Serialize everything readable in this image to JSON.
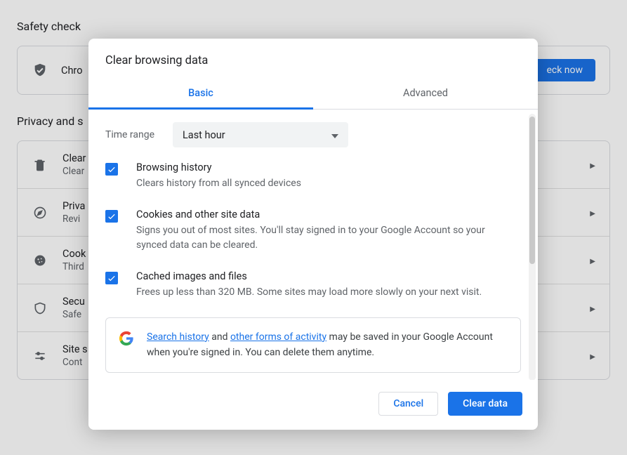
{
  "bg": {
    "safety_title": "Safety check",
    "safety_row_text": "Chro",
    "check_now": "eck now",
    "privacy_title": "Privacy and s",
    "rows": [
      {
        "icon": "trash",
        "p": "Clear",
        "s": "Clear"
      },
      {
        "icon": "compass",
        "p": "Priva",
        "s": "Revi"
      },
      {
        "icon": "cookie",
        "p": "Cook",
        "s": "Third"
      },
      {
        "icon": "shield",
        "p": "Secu",
        "s": "Safe"
      },
      {
        "icon": "sliders",
        "p": "Site s",
        "s": "Cont"
      }
    ]
  },
  "dialog": {
    "title": "Clear browsing data",
    "tabs": {
      "basic": "Basic",
      "advanced": "Advanced"
    },
    "time_range_label": "Time range",
    "time_range_value": "Last hour",
    "items": [
      {
        "title": "Browsing history",
        "desc": "Clears history from all synced devices"
      },
      {
        "title": "Cookies and other site data",
        "desc": "Signs you out of most sites. You'll stay signed in to your Google Account so your synced data can be cleared."
      },
      {
        "title": "Cached images and files",
        "desc": "Frees up less than 320 MB. Some sites may load more slowly on your next visit."
      }
    ],
    "info": {
      "link1": "Search history",
      "mid": " and ",
      "link2": "other forms of activity",
      "rest": " may be saved in your Google Account when you're signed in. You can delete them anytime."
    },
    "buttons": {
      "cancel": "Cancel",
      "clear": "Clear data"
    }
  }
}
